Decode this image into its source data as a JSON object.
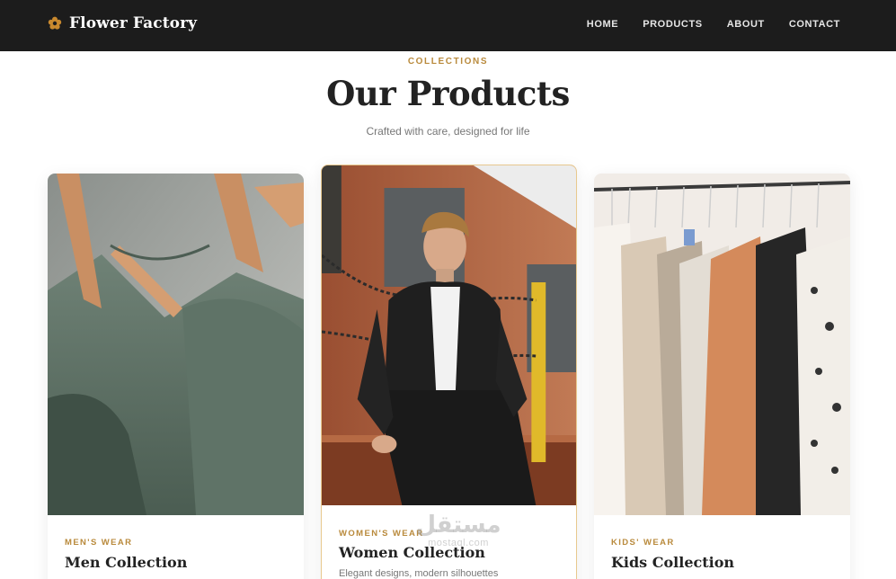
{
  "brand": {
    "name": "Flower Factory",
    "icon": "flower-icon",
    "icon_color": "#c9892e"
  },
  "nav": {
    "items": [
      {
        "label": "HOME"
      },
      {
        "label": "PRODUCTS"
      },
      {
        "label": "ABOUT"
      },
      {
        "label": "CONTACT"
      }
    ]
  },
  "header": {
    "eyebrow": "COLLECTIONS",
    "title": "Our Products",
    "subtitle": "Crafted with care, designed for life"
  },
  "cards": [
    {
      "category": "MEN'S WEAR",
      "title": "Men Collection",
      "image": "green-shirts-on-hangers-photo"
    },
    {
      "category": "WOMEN'S WEAR",
      "title": "Women Collection",
      "description": "Elegant designs, modern silhouettes",
      "image": "man-in-leather-jacket-photo"
    },
    {
      "category": "KIDS' WEAR",
      "title": "Kids Collection",
      "image": "clothing-rack-photo"
    }
  ],
  "watermark": {
    "main": "مستقل",
    "sub": "mostaql.com"
  },
  "colors": {
    "accent": "#b98a3c",
    "navbar_bg": "#1c1c1c",
    "featured_border": "#e8c98f"
  }
}
